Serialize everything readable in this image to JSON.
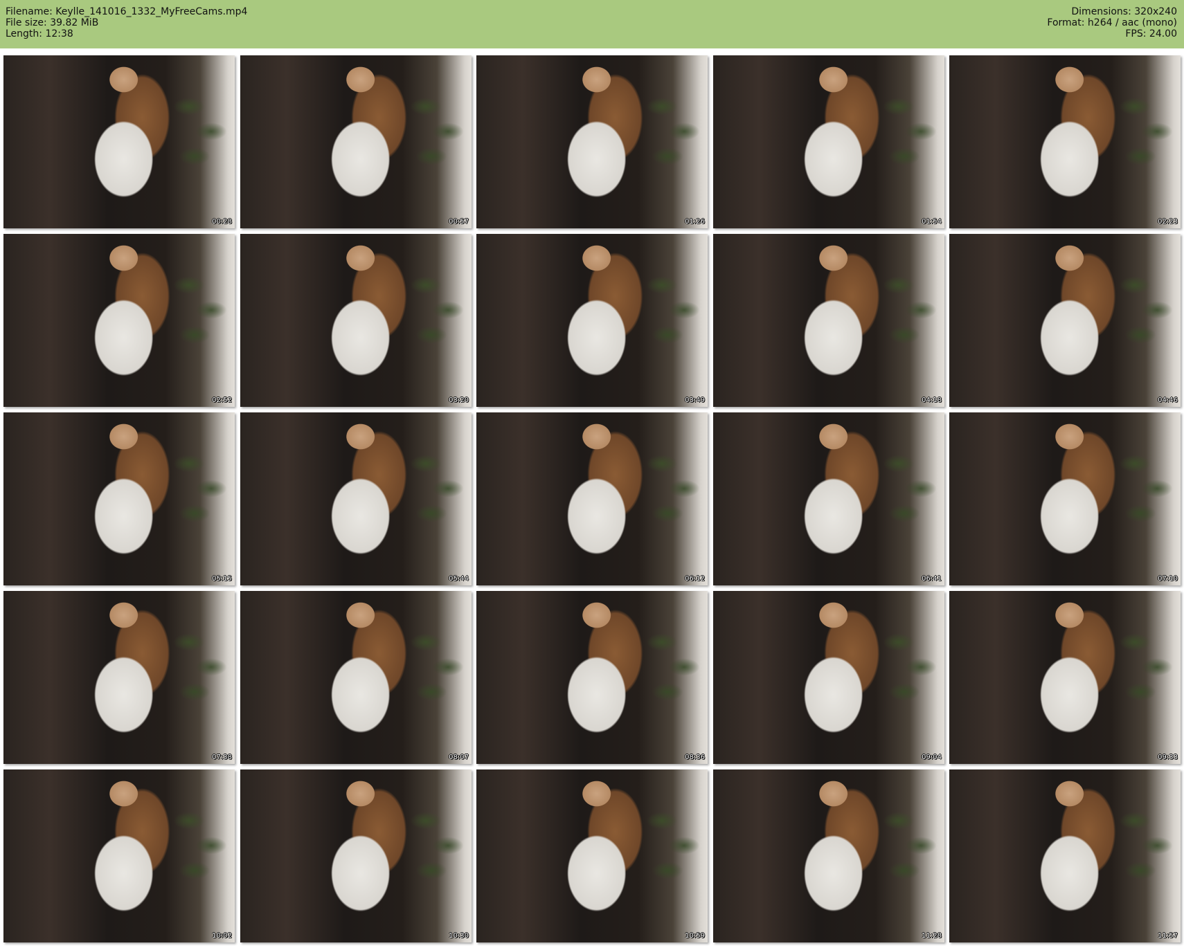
{
  "header": {
    "filename": "Filename: Keylle_141016_1332_MyFreeCams.mp4",
    "file_size": "File size: 39.82 MiB",
    "length": "Length: 12:38",
    "dimensions": "Dimensions: 320x240",
    "format": "Format: h264 / aac (mono)",
    "fps": "FPS: 24.00"
  },
  "colors": {
    "header_bg": "#a9c97f",
    "page_bg": "#ffffff"
  },
  "thumbnails": [
    {
      "timestamp": "00:28"
    },
    {
      "timestamp": "00:57"
    },
    {
      "timestamp": "01:26"
    },
    {
      "timestamp": "01:54"
    },
    {
      "timestamp": "02:23"
    },
    {
      "timestamp": "02:52"
    },
    {
      "timestamp": "03:20"
    },
    {
      "timestamp": "03:49"
    },
    {
      "timestamp": "04:18"
    },
    {
      "timestamp": "04:46"
    },
    {
      "timestamp": "05:15"
    },
    {
      "timestamp": "05:44"
    },
    {
      "timestamp": "06:12"
    },
    {
      "timestamp": "06:41"
    },
    {
      "timestamp": "07:10"
    },
    {
      "timestamp": "07:38"
    },
    {
      "timestamp": "08:07"
    },
    {
      "timestamp": "08:36"
    },
    {
      "timestamp": "09:04"
    },
    {
      "timestamp": "09:33"
    },
    {
      "timestamp": "10:02"
    },
    {
      "timestamp": "10:30"
    },
    {
      "timestamp": "10:59"
    },
    {
      "timestamp": "11:28"
    },
    {
      "timestamp": "11:57"
    }
  ]
}
